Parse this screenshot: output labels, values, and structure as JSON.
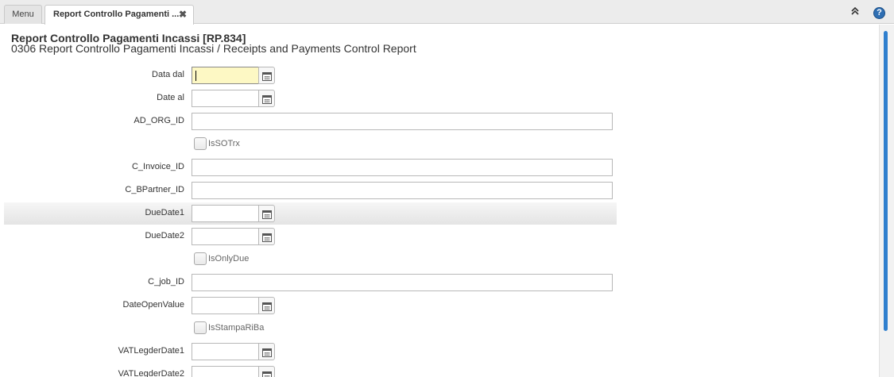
{
  "tabs": {
    "menu_label": "Menu",
    "active_label": "Report Controllo Pagamenti ...",
    "close_symbol": "✖"
  },
  "header": {
    "title": "Report Controllo Pagamenti Incassi [RP.834]",
    "subtitle": "0306 Report Controllo Pagamenti Incassi / Receipts and Payments Control Report"
  },
  "form": {
    "data_dal_label": "Data dal",
    "date_al_label": "Date al",
    "ad_org_id_label": "AD_ORG_ID",
    "issotrx_label": "IsSOTrx",
    "c_invoice_id_label": "C_Invoice_ID",
    "c_bpartner_id_label": "C_BPartner_ID",
    "duedate1_label": "DueDate1",
    "duedate2_label": "DueDate2",
    "isonlydue_label": "IsOnlyDue",
    "c_job_id_label": "C_job_ID",
    "dateopenvalue_label": "DateOpenValue",
    "isstampariba_label": "IsStampaRiBa",
    "vatlegderdate1_label": "VATLegderDate1",
    "vatlegderdate2_label": "VATLegderDate2"
  },
  "icons": {
    "collapse": "double-chevron-up-icon",
    "help": "help-icon",
    "calendar": "calendar-icon"
  },
  "colors": {
    "focused_field": "#fdf8c4",
    "scrollbar": "#2f7fce",
    "help_icon": "#2f6fb3"
  }
}
